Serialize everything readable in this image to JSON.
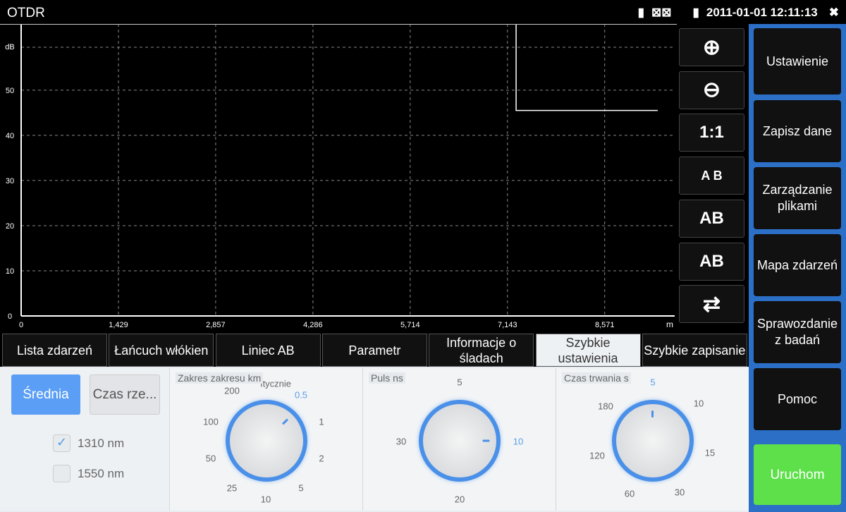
{
  "app": {
    "title": "OTDR",
    "datetime": "2011-01-01 12:11:13",
    "icons": [
      "sd-card-icon",
      "screen-off-icon",
      "screen-icon",
      "battery-icon",
      "close-icon"
    ]
  },
  "chart_data": {
    "type": "line",
    "ylabel": "dB",
    "xlabel": "m",
    "xlim": [
      0,
      10000
    ],
    "ylim": [
      0,
      64.5
    ],
    "x_ticks": [
      0,
      1429,
      2857,
      4286,
      5714,
      7143,
      8571
    ],
    "x_tick_labels": [
      "0",
      "1,429",
      "2,857",
      "4,286",
      "5,714",
      "7,143",
      "8,571"
    ],
    "y_ticks": [
      0,
      10,
      20,
      30,
      40,
      50
    ],
    "y_tick_labels": [
      "0",
      "10",
      "20",
      "30",
      "40",
      "50"
    ],
    "grid": true,
    "series": [
      {
        "name": "trace",
        "x": [
          7270,
          7270,
          9350
        ],
        "y": [
          64.5,
          45.5,
          45.5
        ]
      }
    ]
  },
  "tools": [
    {
      "label": "",
      "icon": "zoom-in-icon"
    },
    {
      "label": "",
      "icon": "zoom-out-icon"
    },
    {
      "label": "1:1"
    },
    {
      "label": "A B",
      "icon": "lock-ab-icon"
    },
    {
      "label": "AB",
      "icon": "move-a-left-icon"
    },
    {
      "label": "AB",
      "icon": "move-b-right-icon"
    },
    {
      "label": "",
      "icon": "swap-icon"
    }
  ],
  "side": [
    "Ustawienie",
    "Zapisz dane",
    "Zarządzanie plikami",
    "Mapa zdarzeń",
    "Sprawozdanie z badań",
    "Pomoc",
    "Uruchom"
  ],
  "tabs": [
    "Lista zdarzeń",
    "Łańcuch włókien",
    "Liniec AB",
    "Parametr",
    "Informacje o śladach",
    "Szybkie ustawienia",
    "Szybkie zapisanie"
  ],
  "panel": {
    "mode_avg": "Średnia",
    "mode_rt": "Czas rze...",
    "wl1": "1310 nm",
    "wl1_checked": true,
    "wl2": "1550 nm",
    "wl2_checked": false,
    "range": {
      "title": "Zakres zakresu km",
      "hidden": "ıtycznie",
      "labels": [
        "200",
        "0.5",
        "100",
        "1",
        "50",
        "2",
        "25",
        "5",
        "10"
      ],
      "selected": "0.5"
    },
    "pulse": {
      "title": "Puls ns",
      "labels": [
        "5",
        "30",
        "10",
        "20"
      ],
      "selected": "10"
    },
    "time": {
      "title": "Czas trwania s",
      "labels": [
        "5",
        "180",
        "10",
        "120",
        "15",
        "60",
        "30"
      ],
      "selected": "5"
    }
  }
}
